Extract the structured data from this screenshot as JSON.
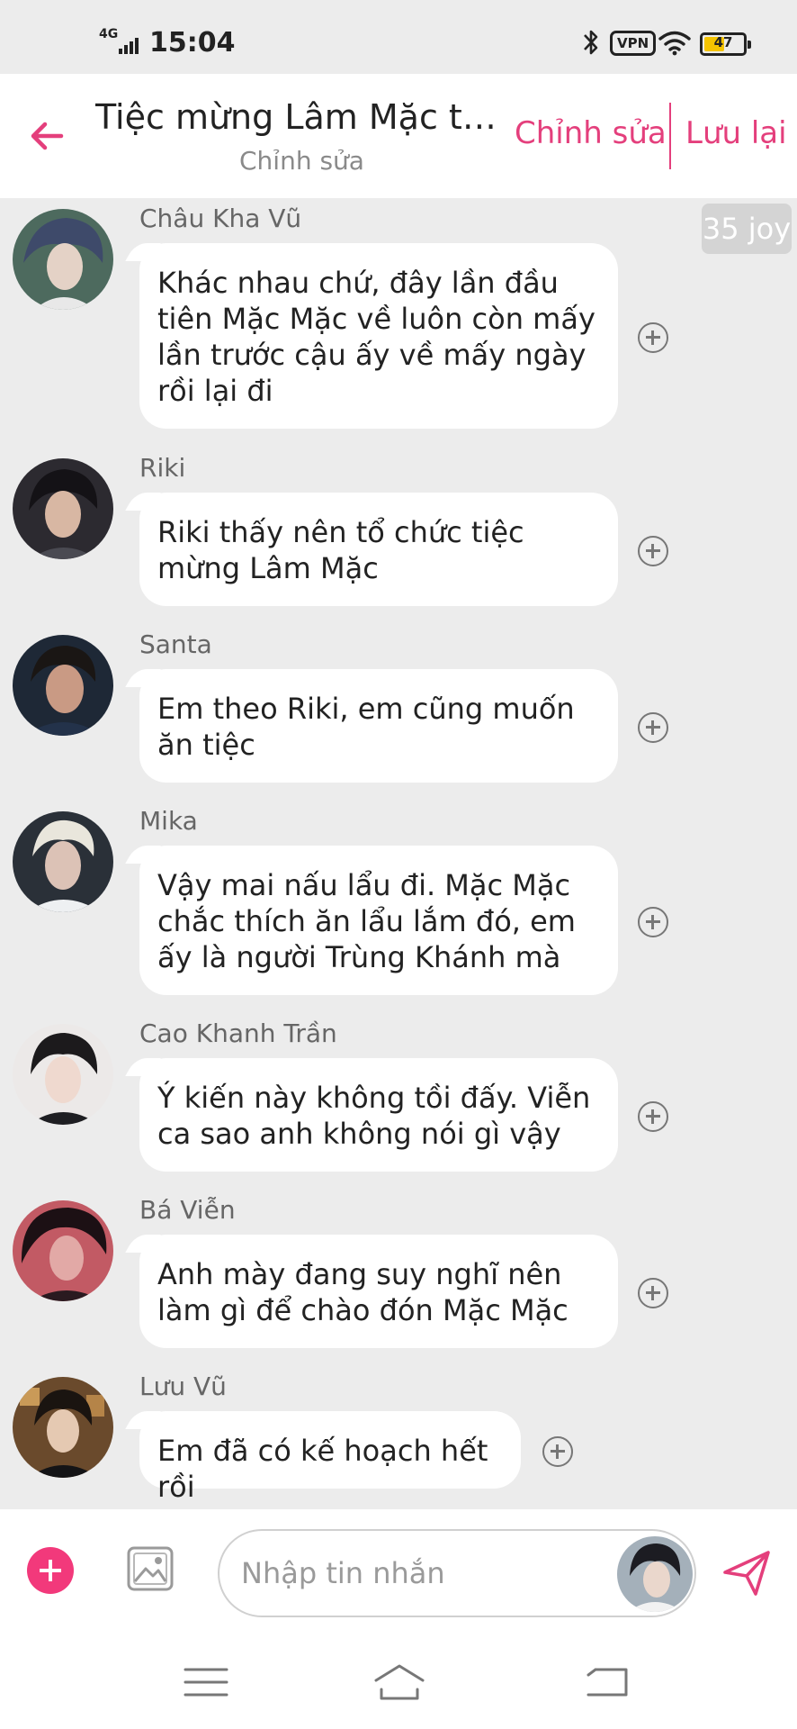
{
  "status_bar": {
    "network": "4G",
    "time": "15:04",
    "vpn_label": "VPN",
    "battery": "47",
    "icons": [
      "signal-icon",
      "bluetooth-icon",
      "vpn-icon",
      "wifi-icon",
      "battery-icon"
    ]
  },
  "header": {
    "title": "Tiệc mừng Lâm Mặc trở …",
    "subtitle": "Chỉnh sửa",
    "edit_label": "Chỉnh sửa",
    "save_label": "Lưu lại",
    "back_icon": "arrow-left-icon"
  },
  "joy_badge": "35 joy",
  "messages": [
    {
      "sender": "Châu Kha Vũ",
      "text": "Khác nhau chứ, đây lần đầu tiên Mặc Mặc về luôn còn mấy lần trước cậu ấy về mấy ngày rồi lại đi"
    },
    {
      "sender": "Riki",
      "text": "Riki thấy nên tổ chức tiệc mừng Lâm Mặc"
    },
    {
      "sender": "Santa",
      "text": "Em theo Riki, em cũng muốn ăn tiệc"
    },
    {
      "sender": "Mika",
      "text": "Vậy mai nấu lẩu đi. Mặc Mặc chắc thích ăn lẩu lắm đó, em ấy là người Trùng Khánh mà"
    },
    {
      "sender": "Cao Khanh Trần",
      "text": "Ý kiến này không tồi đấy. Viễn ca sao anh không nói gì vậy"
    },
    {
      "sender": "Bá Viễn",
      "text": "Anh mày đang suy nghĩ nên làm gì để chào đón Mặc Mặc"
    },
    {
      "sender": "Lưu Vũ",
      "text": "Em đã có kế hoạch hết rồi"
    }
  ],
  "composer": {
    "placeholder": "Nhập tin nhắn",
    "icons": [
      "plus-icon",
      "image-icon",
      "send-icon"
    ]
  },
  "nav_bar": {
    "icons": [
      "menu-icon",
      "home-icon",
      "back-icon"
    ]
  },
  "colors": {
    "accent": "#e43f7c",
    "plus_button": "#f2397b",
    "chat_background": "#ececec",
    "bubble": "#ffffff"
  }
}
